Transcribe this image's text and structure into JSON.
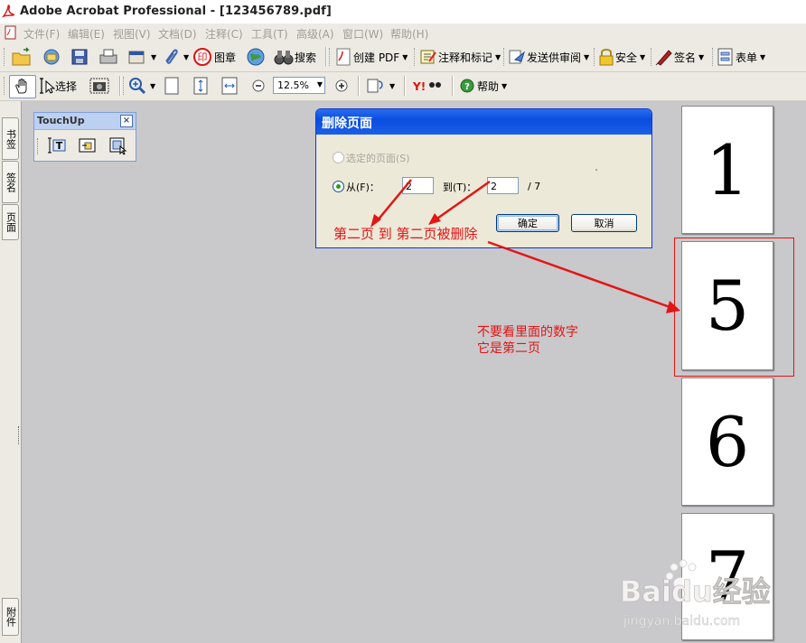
{
  "window": {
    "title": "Adobe Acrobat Professional - [123456789.pdf]"
  },
  "menubar": {
    "items": [
      "文件(F)",
      "编辑(E)",
      "视图(V)",
      "文档(D)",
      "注释(C)",
      "工具(T)",
      "高级(A)",
      "窗口(W)",
      "帮助(H)"
    ]
  },
  "toolbar1": {
    "stamp_label": "图章",
    "search_label": "搜索",
    "create_pdf_label": "创建 PDF",
    "comment_label": "注释和标记",
    "review_label": "发送供审阅",
    "security_label": "安全",
    "sign_label": "签名",
    "forms_label": "表单"
  },
  "toolbar2": {
    "select_label": "选择",
    "zoom_value": "12.5%",
    "help_label": "帮助"
  },
  "left_panel": {
    "tabs": [
      "书签",
      "签名",
      "页面"
    ],
    "bottom_tab": "附件"
  },
  "touchup": {
    "title": "TouchUp",
    "close": "×"
  },
  "dialog": {
    "title": "删除页面",
    "option_selected": "选定的页面(S)",
    "option_from": "从(F)：",
    "from_value": "2",
    "to_label": "到(T)：",
    "to_value": "2",
    "total": "/ 7",
    "ok": "确定",
    "cancel": "取消"
  },
  "pages": [
    "1",
    "5",
    "6",
    "7"
  ],
  "annotations": {
    "deleted_note": "第二页 到 第二页被删除",
    "page_note_line1": "不要看里面的数字",
    "page_note_line2": "它是第二页"
  },
  "watermark": {
    "brand": "Baidu经验",
    "url": "jingyan.baidu.com"
  },
  "colors": {
    "annotation": "#e31515",
    "dialog_title_bar": "#0a4ee0",
    "canvas": "#c9c8cb"
  }
}
